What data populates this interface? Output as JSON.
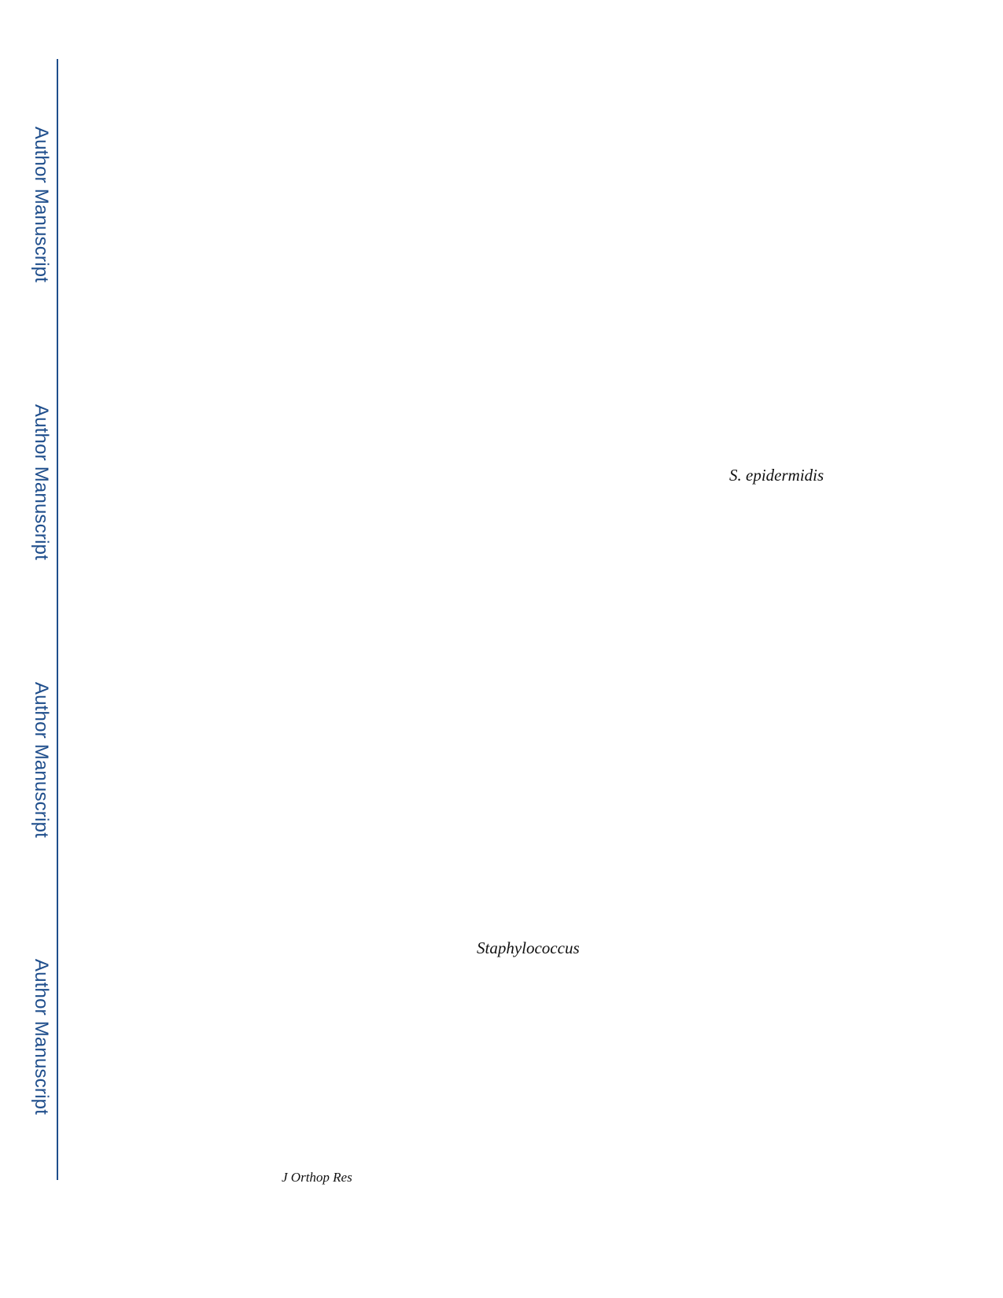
{
  "sidebar": {
    "watermark_labels": [
      "Author Manuscript",
      "Author Manuscript",
      "Author Manuscript",
      "Author Manuscript"
    ],
    "color": "#1f4e8c"
  },
  "body": {
    "terms": {
      "epidermidis": "S. epidermidis",
      "staphylococcus": "Staphylococcus"
    }
  },
  "footer": {
    "journal": "J Orthop Res"
  }
}
